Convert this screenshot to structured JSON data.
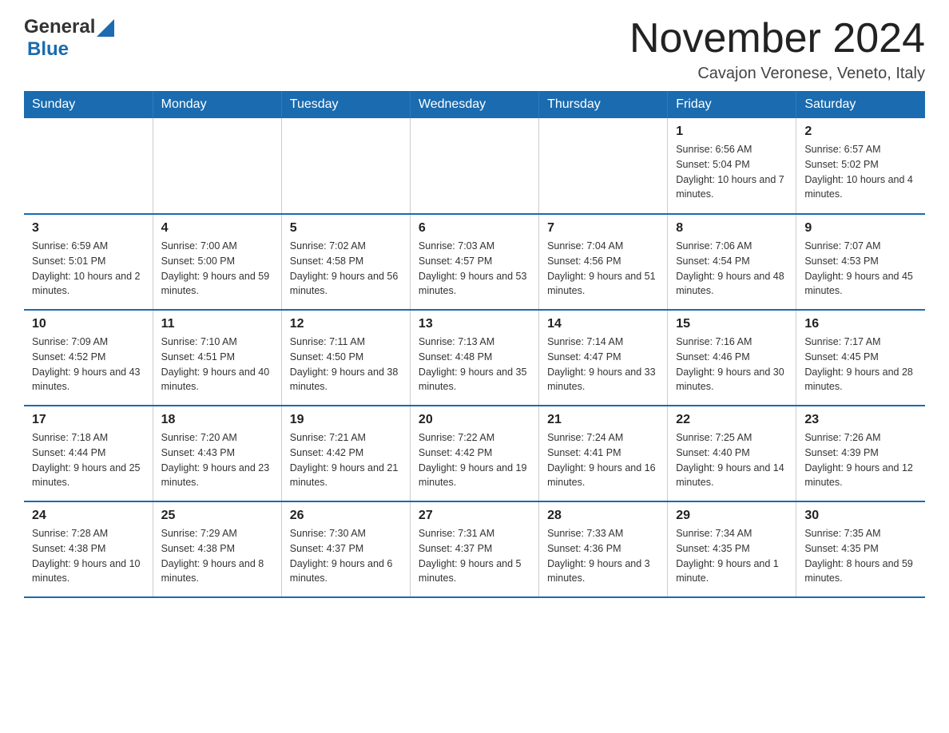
{
  "header": {
    "logo_general": "General",
    "logo_blue": "Blue",
    "month_title": "November 2024",
    "location": "Cavajon Veronese, Veneto, Italy"
  },
  "weekdays": [
    "Sunday",
    "Monday",
    "Tuesday",
    "Wednesday",
    "Thursday",
    "Friday",
    "Saturday"
  ],
  "weeks": [
    [
      {
        "day": "",
        "sunrise": "",
        "sunset": "",
        "daylight": ""
      },
      {
        "day": "",
        "sunrise": "",
        "sunset": "",
        "daylight": ""
      },
      {
        "day": "",
        "sunrise": "",
        "sunset": "",
        "daylight": ""
      },
      {
        "day": "",
        "sunrise": "",
        "sunset": "",
        "daylight": ""
      },
      {
        "day": "",
        "sunrise": "",
        "sunset": "",
        "daylight": ""
      },
      {
        "day": "1",
        "sunrise": "Sunrise: 6:56 AM",
        "sunset": "Sunset: 5:04 PM",
        "daylight": "Daylight: 10 hours and 7 minutes."
      },
      {
        "day": "2",
        "sunrise": "Sunrise: 6:57 AM",
        "sunset": "Sunset: 5:02 PM",
        "daylight": "Daylight: 10 hours and 4 minutes."
      }
    ],
    [
      {
        "day": "3",
        "sunrise": "Sunrise: 6:59 AM",
        "sunset": "Sunset: 5:01 PM",
        "daylight": "Daylight: 10 hours and 2 minutes."
      },
      {
        "day": "4",
        "sunrise": "Sunrise: 7:00 AM",
        "sunset": "Sunset: 5:00 PM",
        "daylight": "Daylight: 9 hours and 59 minutes."
      },
      {
        "day": "5",
        "sunrise": "Sunrise: 7:02 AM",
        "sunset": "Sunset: 4:58 PM",
        "daylight": "Daylight: 9 hours and 56 minutes."
      },
      {
        "day": "6",
        "sunrise": "Sunrise: 7:03 AM",
        "sunset": "Sunset: 4:57 PM",
        "daylight": "Daylight: 9 hours and 53 minutes."
      },
      {
        "day": "7",
        "sunrise": "Sunrise: 7:04 AM",
        "sunset": "Sunset: 4:56 PM",
        "daylight": "Daylight: 9 hours and 51 minutes."
      },
      {
        "day": "8",
        "sunrise": "Sunrise: 7:06 AM",
        "sunset": "Sunset: 4:54 PM",
        "daylight": "Daylight: 9 hours and 48 minutes."
      },
      {
        "day": "9",
        "sunrise": "Sunrise: 7:07 AM",
        "sunset": "Sunset: 4:53 PM",
        "daylight": "Daylight: 9 hours and 45 minutes."
      }
    ],
    [
      {
        "day": "10",
        "sunrise": "Sunrise: 7:09 AM",
        "sunset": "Sunset: 4:52 PM",
        "daylight": "Daylight: 9 hours and 43 minutes."
      },
      {
        "day": "11",
        "sunrise": "Sunrise: 7:10 AM",
        "sunset": "Sunset: 4:51 PM",
        "daylight": "Daylight: 9 hours and 40 minutes."
      },
      {
        "day": "12",
        "sunrise": "Sunrise: 7:11 AM",
        "sunset": "Sunset: 4:50 PM",
        "daylight": "Daylight: 9 hours and 38 minutes."
      },
      {
        "day": "13",
        "sunrise": "Sunrise: 7:13 AM",
        "sunset": "Sunset: 4:48 PM",
        "daylight": "Daylight: 9 hours and 35 minutes."
      },
      {
        "day": "14",
        "sunrise": "Sunrise: 7:14 AM",
        "sunset": "Sunset: 4:47 PM",
        "daylight": "Daylight: 9 hours and 33 minutes."
      },
      {
        "day": "15",
        "sunrise": "Sunrise: 7:16 AM",
        "sunset": "Sunset: 4:46 PM",
        "daylight": "Daylight: 9 hours and 30 minutes."
      },
      {
        "day": "16",
        "sunrise": "Sunrise: 7:17 AM",
        "sunset": "Sunset: 4:45 PM",
        "daylight": "Daylight: 9 hours and 28 minutes."
      }
    ],
    [
      {
        "day": "17",
        "sunrise": "Sunrise: 7:18 AM",
        "sunset": "Sunset: 4:44 PM",
        "daylight": "Daylight: 9 hours and 25 minutes."
      },
      {
        "day": "18",
        "sunrise": "Sunrise: 7:20 AM",
        "sunset": "Sunset: 4:43 PM",
        "daylight": "Daylight: 9 hours and 23 minutes."
      },
      {
        "day": "19",
        "sunrise": "Sunrise: 7:21 AM",
        "sunset": "Sunset: 4:42 PM",
        "daylight": "Daylight: 9 hours and 21 minutes."
      },
      {
        "day": "20",
        "sunrise": "Sunrise: 7:22 AM",
        "sunset": "Sunset: 4:42 PM",
        "daylight": "Daylight: 9 hours and 19 minutes."
      },
      {
        "day": "21",
        "sunrise": "Sunrise: 7:24 AM",
        "sunset": "Sunset: 4:41 PM",
        "daylight": "Daylight: 9 hours and 16 minutes."
      },
      {
        "day": "22",
        "sunrise": "Sunrise: 7:25 AM",
        "sunset": "Sunset: 4:40 PM",
        "daylight": "Daylight: 9 hours and 14 minutes."
      },
      {
        "day": "23",
        "sunrise": "Sunrise: 7:26 AM",
        "sunset": "Sunset: 4:39 PM",
        "daylight": "Daylight: 9 hours and 12 minutes."
      }
    ],
    [
      {
        "day": "24",
        "sunrise": "Sunrise: 7:28 AM",
        "sunset": "Sunset: 4:38 PM",
        "daylight": "Daylight: 9 hours and 10 minutes."
      },
      {
        "day": "25",
        "sunrise": "Sunrise: 7:29 AM",
        "sunset": "Sunset: 4:38 PM",
        "daylight": "Daylight: 9 hours and 8 minutes."
      },
      {
        "day": "26",
        "sunrise": "Sunrise: 7:30 AM",
        "sunset": "Sunset: 4:37 PM",
        "daylight": "Daylight: 9 hours and 6 minutes."
      },
      {
        "day": "27",
        "sunrise": "Sunrise: 7:31 AM",
        "sunset": "Sunset: 4:37 PM",
        "daylight": "Daylight: 9 hours and 5 minutes."
      },
      {
        "day": "28",
        "sunrise": "Sunrise: 7:33 AM",
        "sunset": "Sunset: 4:36 PM",
        "daylight": "Daylight: 9 hours and 3 minutes."
      },
      {
        "day": "29",
        "sunrise": "Sunrise: 7:34 AM",
        "sunset": "Sunset: 4:35 PM",
        "daylight": "Daylight: 9 hours and 1 minute."
      },
      {
        "day": "30",
        "sunrise": "Sunrise: 7:35 AM",
        "sunset": "Sunset: 4:35 PM",
        "daylight": "Daylight: 8 hours and 59 minutes."
      }
    ]
  ]
}
